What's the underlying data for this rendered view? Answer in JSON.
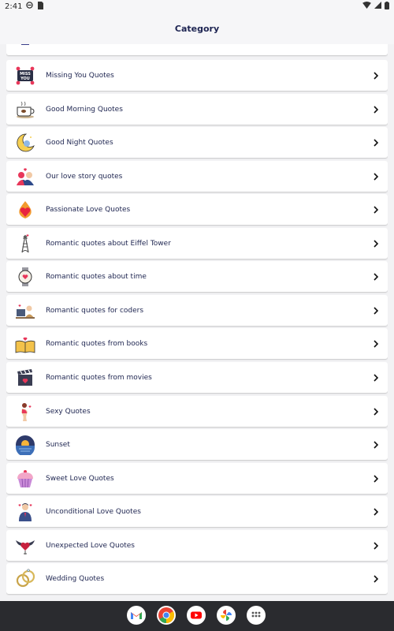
{
  "status": {
    "time": "2:41"
  },
  "header": {
    "title": "Category"
  },
  "categories": [
    {
      "label": "Missing You Quotes"
    },
    {
      "label": "Good Morning Quotes"
    },
    {
      "label": "Good Night Quotes"
    },
    {
      "label": "Our love story quotes"
    },
    {
      "label": "Passionate Love Quotes"
    },
    {
      "label": "Romantic quotes about Eiffel Tower"
    },
    {
      "label": "Romantic quotes about time"
    },
    {
      "label": "Romantic quotes for coders"
    },
    {
      "label": "Romantic quotes from books"
    },
    {
      "label": "Romantic quotes from movies"
    },
    {
      "label": "Sexy Quotes"
    },
    {
      "label": "Sunset"
    },
    {
      "label": "Sweet Love Quotes"
    },
    {
      "label": "Unconditional Love Quotes"
    },
    {
      "label": "Unexpected Love Quotes"
    },
    {
      "label": "Wedding Quotes"
    }
  ],
  "icons": {
    "missing_you": "missing-you-sign-icon",
    "good_morning": "coffee-cup-icon",
    "good_night": "moon-icon",
    "love_story": "couple-icon",
    "passionate": "flame-heart-icon",
    "eiffel": "eiffel-tower-icon",
    "time": "watch-icon",
    "coders": "computer-coder-icon",
    "books": "open-book-icon",
    "movies": "clapperboard-icon",
    "sexy": "pin-up-girl-icon",
    "sunset": "sunset-icon",
    "sweet": "cupcake-icon",
    "unconditional": "guy-with-hearts-icon",
    "unexpected": "winged-heart-icon",
    "wedding": "wedding-rings-icon",
    "chevron": "chevron-right-icon"
  },
  "dock": [
    "gmail-icon",
    "chrome-icon",
    "youtube-icon",
    "photos-icon",
    "app-drawer-icon"
  ],
  "colors": {
    "title": "#1d2452",
    "label": "#1e2550",
    "background": "#f2f2f4",
    "nav_bar": "#2a2b2f"
  }
}
